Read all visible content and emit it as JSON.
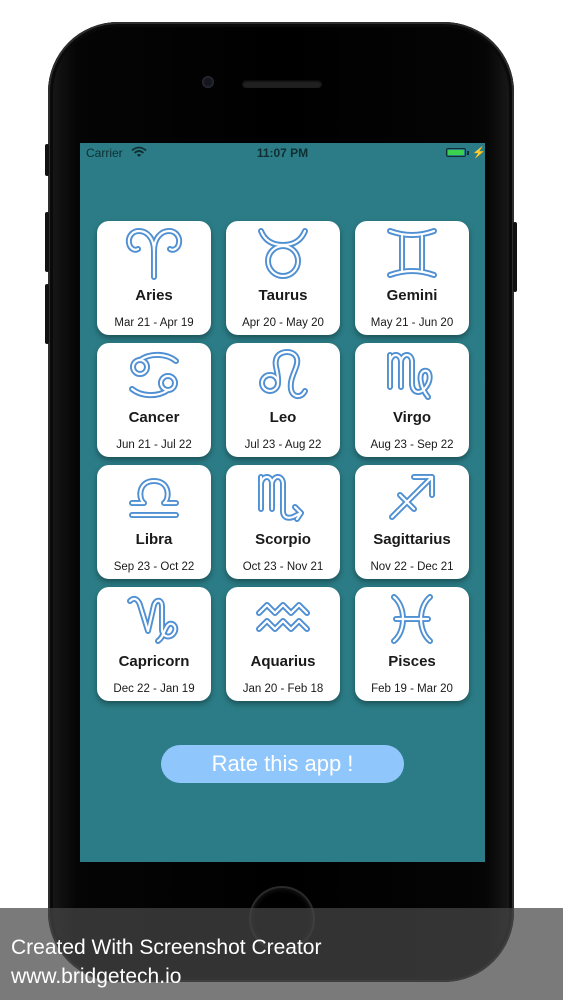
{
  "status_bar": {
    "carrier": "Carrier",
    "time": "11:07 PM",
    "battery_color": "#3bd24c"
  },
  "zodiac": [
    {
      "name": "Aries",
      "dates": "Mar 21 - Apr 19",
      "icon": "aries-icon"
    },
    {
      "name": "Taurus",
      "dates": "Apr 20 - May 20",
      "icon": "taurus-icon"
    },
    {
      "name": "Gemini",
      "dates": "May 21 - Jun 20",
      "icon": "gemini-icon"
    },
    {
      "name": "Cancer",
      "dates": "Jun 21 - Jul 22",
      "icon": "cancer-icon"
    },
    {
      "name": "Leo",
      "dates": "Jul 23 - Aug 22",
      "icon": "leo-icon"
    },
    {
      "name": "Virgo",
      "dates": "Aug 23 - Sep 22",
      "icon": "virgo-icon"
    },
    {
      "name": "Libra",
      "dates": "Sep 23 - Oct 22",
      "icon": "libra-icon"
    },
    {
      "name": "Scorpio",
      "dates": "Oct 23 - Nov 21",
      "icon": "scorpio-icon"
    },
    {
      "name": "Sagittarius",
      "dates": "Nov 22 - Dec 21",
      "icon": "sagittarius-icon"
    },
    {
      "name": "Capricorn",
      "dates": "Dec 22 - Jan 19",
      "icon": "capricorn-icon"
    },
    {
      "name": "Aquarius",
      "dates": "Jan 20 - Feb 18",
      "icon": "aquarius-icon"
    },
    {
      "name": "Pisces",
      "dates": "Feb 19 - Mar 20",
      "icon": "pisces-icon"
    }
  ],
  "rate_button": {
    "label": "Rate this app !"
  },
  "colors": {
    "background": "#2b7c86",
    "card": "#ffffff",
    "glyph": "#4f8fd3",
    "rate_button": "#8fc6fb"
  },
  "watermark": {
    "line1": "Created With Screenshot Creator",
    "line2": "www.bridgetech.io"
  }
}
